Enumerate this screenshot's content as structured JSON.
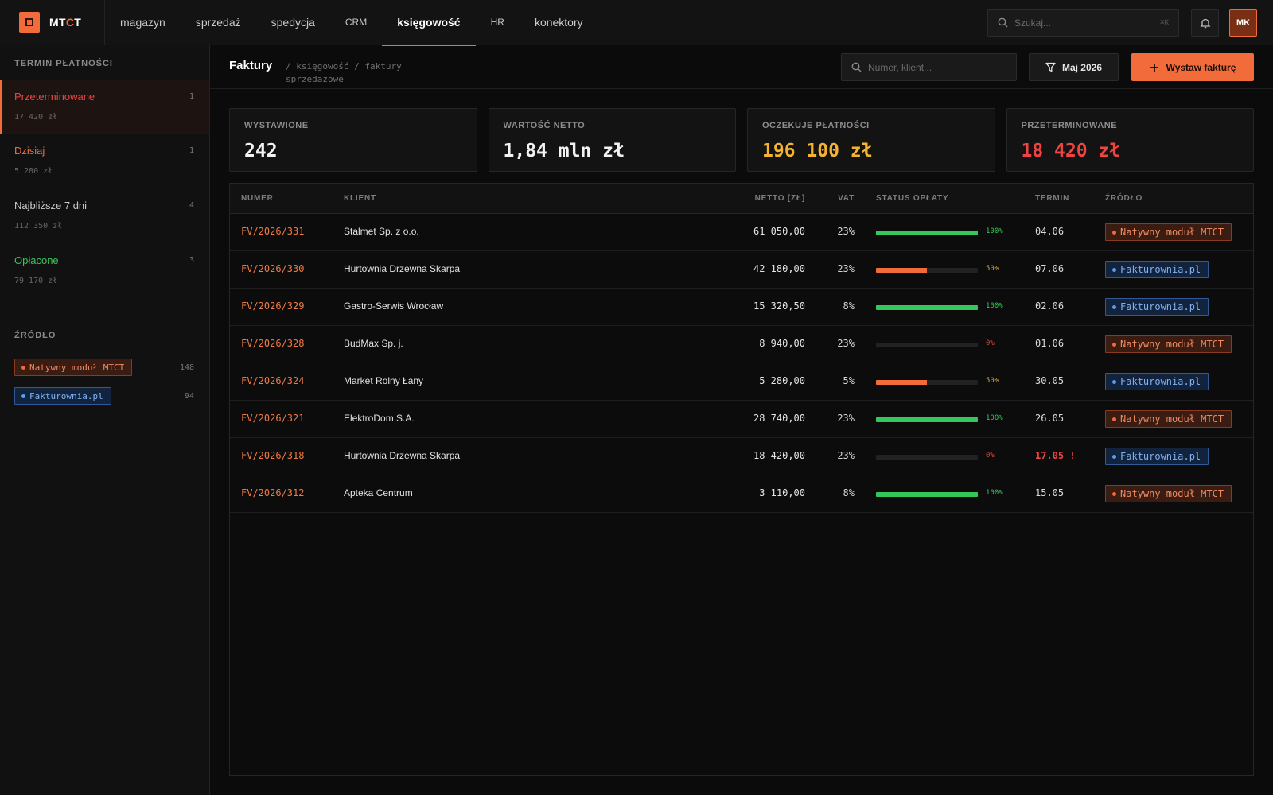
{
  "app": {
    "brand": {
      "pre": "MT",
      "accent": "C",
      "post": "T"
    },
    "nav": [
      {
        "label": "magazyn",
        "active": false
      },
      {
        "label": "sprzedaż",
        "active": false
      },
      {
        "label": "spedycja",
        "active": false
      },
      {
        "label": "CRM",
        "active": false
      },
      {
        "label": "księgowość",
        "active": true
      },
      {
        "label": "HR",
        "active": false
      },
      {
        "label": "konektory",
        "active": false
      }
    ],
    "search_placeholder": "Szukaj...",
    "search_shortcut": "⌘K",
    "avatar_initials": "MK"
  },
  "sidebar": {
    "due_heading": "TERMIN PŁATNOŚCI",
    "due_items": [
      {
        "label": "Przeterminowane",
        "count": "1",
        "amount": "17 420 zł",
        "color": "#ef4444",
        "active": true
      },
      {
        "label": "Dzisiaj",
        "count": "1",
        "amount": "5 280 zł",
        "color": "#f26b3a",
        "active": false
      },
      {
        "label": "Najbliższe 7 dni",
        "count": "4",
        "amount": "112 350 zł",
        "color": "#c9c9c9",
        "active": false
      },
      {
        "label": "Opłacone",
        "count": "3",
        "amount": "79 170 zł",
        "color": "#34c759",
        "active": false
      }
    ],
    "source_heading": "ŹRÓDŁO",
    "sources": [
      {
        "label": "Natywny moduł MTCT",
        "count": "148",
        "kind": "native"
      },
      {
        "label": "Fakturownia.pl",
        "count": "94",
        "kind": "fakt"
      }
    ]
  },
  "page": {
    "title": "Faktury",
    "breadcrumb": "/ księgowość / faktury sprzedażowe",
    "filter_placeholder": "Numer, klient...",
    "month_label": "Maj 2026",
    "primary_label": "Wystaw fakturę"
  },
  "stats": [
    {
      "title": "WYSTAWIONE",
      "value": "242",
      "tone": ""
    },
    {
      "title": "WARTOŚĆ NETTO",
      "value": "1,84 mln zł",
      "tone": ""
    },
    {
      "title": "OCZEKUJE PŁATNOŚCI",
      "value": "196 100 zł",
      "tone": "amber"
    },
    {
      "title": "PRZETERMINOWANE",
      "value": "18 420 zł",
      "tone": "red"
    }
  ],
  "table": {
    "columns": {
      "number": "NUMER",
      "client": "KLIENT",
      "net": "NETTO [ZŁ]",
      "vat": "VAT",
      "status": "STATUS OPŁATY",
      "due": "TERMIN",
      "source": "ŹRÓDŁO"
    },
    "rows": [
      {
        "number": "FV/2026/331",
        "client": "Stalmet Sp. z o.o.",
        "net": "61 050,00",
        "vat": "23%",
        "paid": 1.0,
        "pct": "100%",
        "due": "04.06",
        "late": false,
        "source": "Natywny moduł MTCT",
        "kind": "native"
      },
      {
        "number": "FV/2026/330",
        "client": "Hurtownia Drzewna Skarpa",
        "net": "42 180,00",
        "vat": "23%",
        "paid": 0.5,
        "pct": "50%",
        "due": "07.06",
        "late": false,
        "source": "Fakturownia.pl",
        "kind": "fakt"
      },
      {
        "number": "FV/2026/329",
        "client": "Gastro-Serwis Wrocław",
        "net": "15 320,50",
        "vat": "8%",
        "paid": 1.0,
        "pct": "100%",
        "due": "02.06",
        "late": false,
        "source": "Fakturownia.pl",
        "kind": "fakt"
      },
      {
        "number": "FV/2026/328",
        "client": "BudMax Sp. j.",
        "net": "8 940,00",
        "vat": "23%",
        "paid": 0.0,
        "pct": "0%",
        "due": "01.06",
        "late": false,
        "source": "Natywny moduł MTCT",
        "kind": "native"
      },
      {
        "number": "FV/2026/324",
        "client": "Market Rolny Łany",
        "net": "5 280,00",
        "vat": "5%",
        "paid": 0.5,
        "pct": "50%",
        "due": "30.05",
        "late": false,
        "source": "Fakturownia.pl",
        "kind": "fakt"
      },
      {
        "number": "FV/2026/321",
        "client": "ElektroDom S.A.",
        "net": "28 740,00",
        "vat": "23%",
        "paid": 1.0,
        "pct": "100%",
        "due": "26.05",
        "late": false,
        "source": "Natywny moduł MTCT",
        "kind": "native"
      },
      {
        "number": "FV/2026/318",
        "client": "Hurtownia Drzewna Skarpa",
        "net": "18 420,00",
        "vat": "23%",
        "paid": 0.0,
        "pct": "0%",
        "due": "17.05 !",
        "late": true,
        "source": "Fakturownia.pl",
        "kind": "fakt"
      },
      {
        "number": "FV/2026/312",
        "client": "Apteka Centrum",
        "net": "3 110,00",
        "vat": "8%",
        "paid": 1.0,
        "pct": "100%",
        "due": "15.05",
        "late": false,
        "source": "Natywny moduł MTCT",
        "kind": "native"
      }
    ]
  },
  "colors": {
    "accent": "#f26b3a",
    "paid_full": "#34c759",
    "paid_partial": "#f26b3a",
    "pct_full": "#34c759",
    "pct_partial": "#e0a030",
    "pct_none": "#e0442e"
  }
}
